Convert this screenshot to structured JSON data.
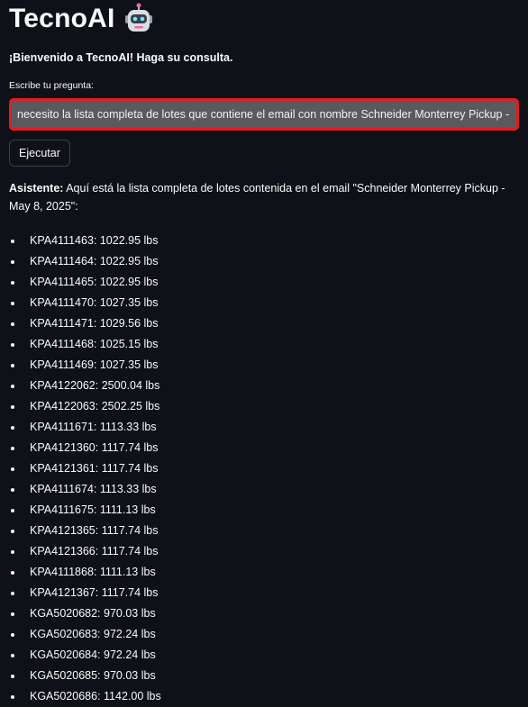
{
  "app": {
    "title": "TecnoAI",
    "welcome": "¡Bienvenido a TecnoAI! Haga su consulta."
  },
  "question": {
    "label": "Escribe tu pregunta:",
    "value": "necesito la lista completa de lotes que contiene el email con nombre Schneider Monterrey Pickup - May"
  },
  "run_button": {
    "label": "Ejecutar"
  },
  "answer": {
    "speaker": "Asistente:",
    "text": " Aquí está la lista completa de lotes contenida en el email \"Schneider Monterrey Pickup - May 8, 2025\":"
  },
  "lots": [
    {
      "id": "KPA4111463:",
      "weight": " 1022.95 lbs"
    },
    {
      "id": "KPA4111464:",
      "weight": " 1022.95 lbs"
    },
    {
      "id": "KPA4111465:",
      "weight": " 1022.95 lbs"
    },
    {
      "id": "KPA4111470:",
      "weight": " 1027.35 lbs"
    },
    {
      "id": "KPA4111471:",
      "weight": " 1029.56 lbs"
    },
    {
      "id": "KPA4111468:",
      "weight": " 1025.15 lbs"
    },
    {
      "id": "KPA4111469:",
      "weight": " 1027.35 lbs"
    },
    {
      "id": "KPA4122062:",
      "weight": " 2500.04 lbs"
    },
    {
      "id": "KPA4122063:",
      "weight": " 2502.25 lbs"
    },
    {
      "id": "KPA4111671:",
      "weight": " 1113.33 lbs"
    },
    {
      "id": "KPA4121360:",
      "weight": " 1117.74 lbs"
    },
    {
      "id": "KPA4121361:",
      "weight": " 1117.74 lbs"
    },
    {
      "id": "KPA4111674:",
      "weight": " 1113.33 lbs"
    },
    {
      "id": "KPA4111675:",
      "weight": " 1111.13 lbs"
    },
    {
      "id": "KPA4121365:",
      "weight": " 1117.74 lbs"
    },
    {
      "id": "KPA4121366:",
      "weight": " 1117.74 lbs"
    },
    {
      "id": "KPA4111868:",
      "weight": " 1111.13 lbs"
    },
    {
      "id": "KPA4121367:",
      "weight": " 1117.74 lbs"
    },
    {
      "id": "KGA5020682:",
      "weight": " 970.03 lbs"
    },
    {
      "id": "KGA5020683:",
      "weight": " 972.24 lbs"
    },
    {
      "id": "KGA5020684:",
      "weight": " 972.24 lbs"
    },
    {
      "id": "KGA5020685:",
      "weight": " 970.03 lbs"
    },
    {
      "id": "KGA5020686:",
      "weight": " 1142.00 lbs"
    }
  ],
  "icons": {
    "title_icon": "robot-icon"
  },
  "colors": {
    "background": "#0e1117",
    "input_border": "#e01e1e",
    "input_bg": "#5a5a5e"
  }
}
